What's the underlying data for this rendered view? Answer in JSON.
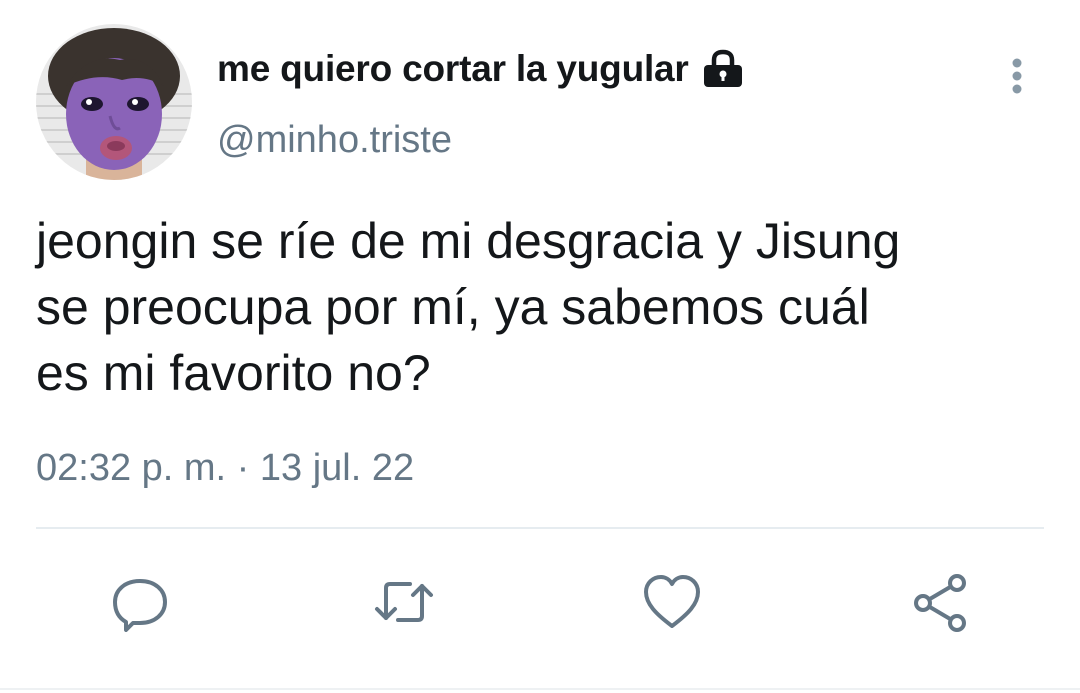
{
  "tweet": {
    "display_name": "me quiero cortar la yugular",
    "handle": "@minho.triste",
    "text_lines": [
      "jeongin se ríe de mi desgracia y Jisung",
      "se preocupa por mí, ya sabemos cuál",
      "es mi favorito no?"
    ],
    "timestamp": "02:32 p. m. · 13 jul. 22"
  },
  "icons": {
    "lock": "lock-icon",
    "more": "more-vertical-icon",
    "reply": "reply-icon",
    "retweet": "retweet-icon",
    "like": "heart-icon",
    "share": "share-icon"
  },
  "colors": {
    "text": "#14171a",
    "secondary": "#657786",
    "divider": "#e6ecf0",
    "avatar_skin": "#8a63b8"
  }
}
